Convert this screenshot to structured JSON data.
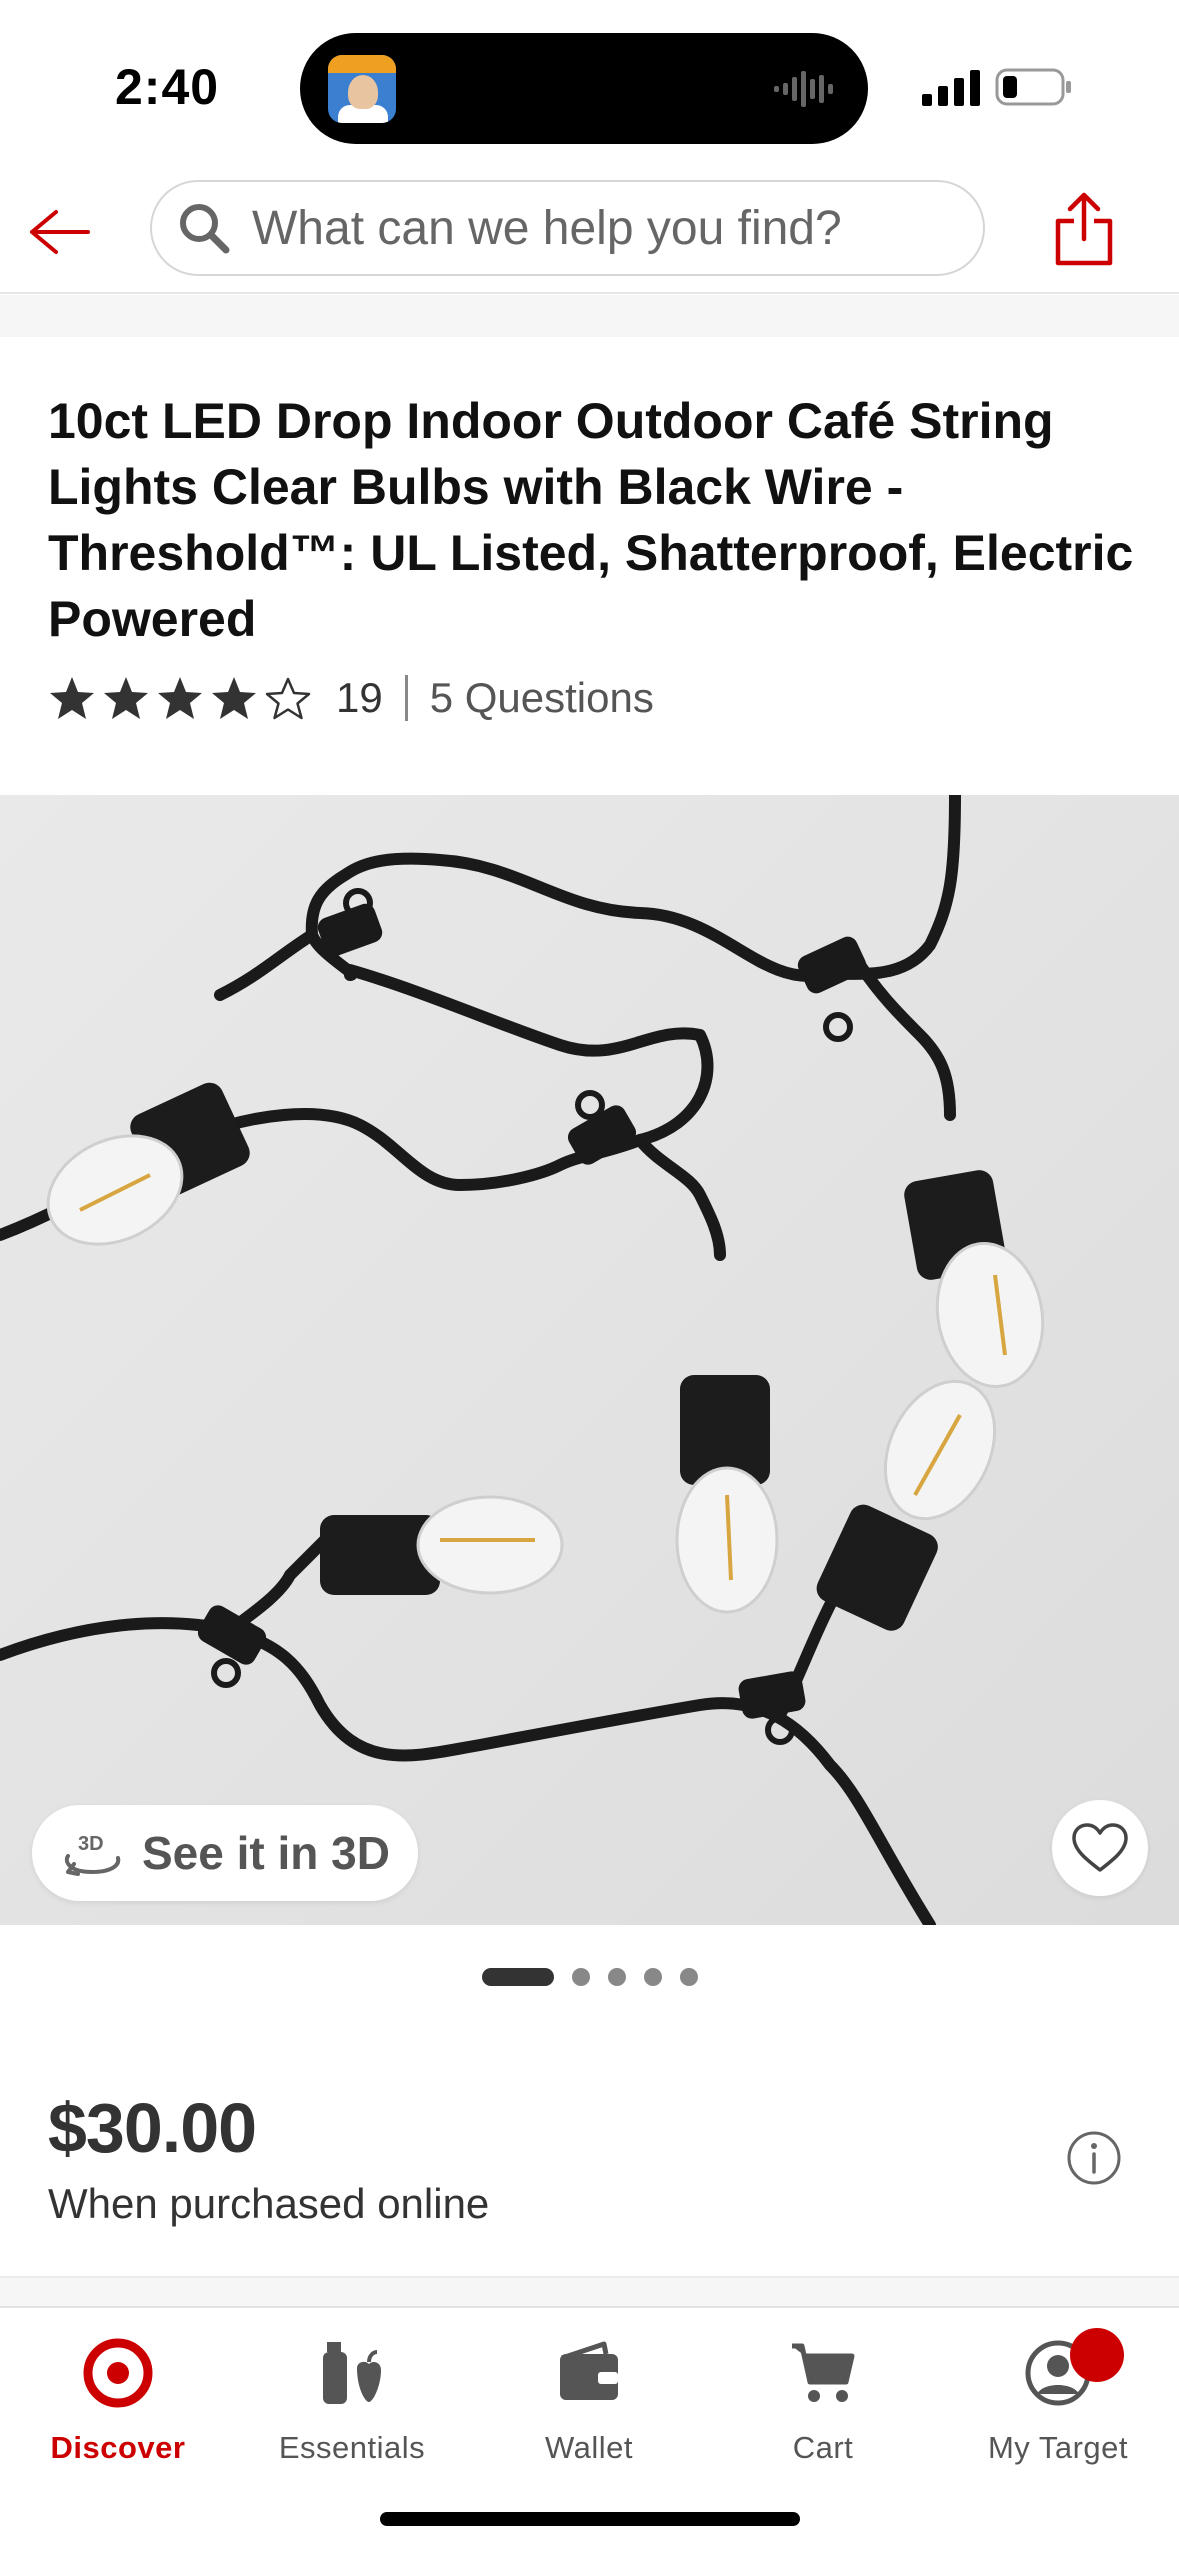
{
  "status_bar": {
    "time": "2:40"
  },
  "header": {
    "search_placeholder": "What can we help you find?",
    "icons": [
      "back-arrow-icon",
      "search-icon",
      "share-icon"
    ],
    "accent_color": "#cc0000"
  },
  "product": {
    "title": "10ct LED Drop Indoor Outdoor Café String Lights Clear Bulbs with Black Wire - Threshold™: UL Listed, Shatterproof, Electric Powered",
    "rating": 4,
    "rating_max": 5,
    "review_count": "19",
    "questions_label": "5 Questions",
    "see_3d_label": "See it in 3D",
    "image_count": 5,
    "active_image": 1
  },
  "price": {
    "amount": "$30.00",
    "note": "When purchased online"
  },
  "tabbar": {
    "items": [
      {
        "label": "Discover",
        "icon": "target-logo-icon",
        "active": true
      },
      {
        "label": "Essentials",
        "icon": "essentials-icon",
        "active": false
      },
      {
        "label": "Wallet",
        "icon": "wallet-icon",
        "active": false
      },
      {
        "label": "Cart",
        "icon": "cart-icon",
        "active": false
      },
      {
        "label": "My Target",
        "icon": "profile-icon",
        "active": false,
        "badge": true
      }
    ]
  }
}
